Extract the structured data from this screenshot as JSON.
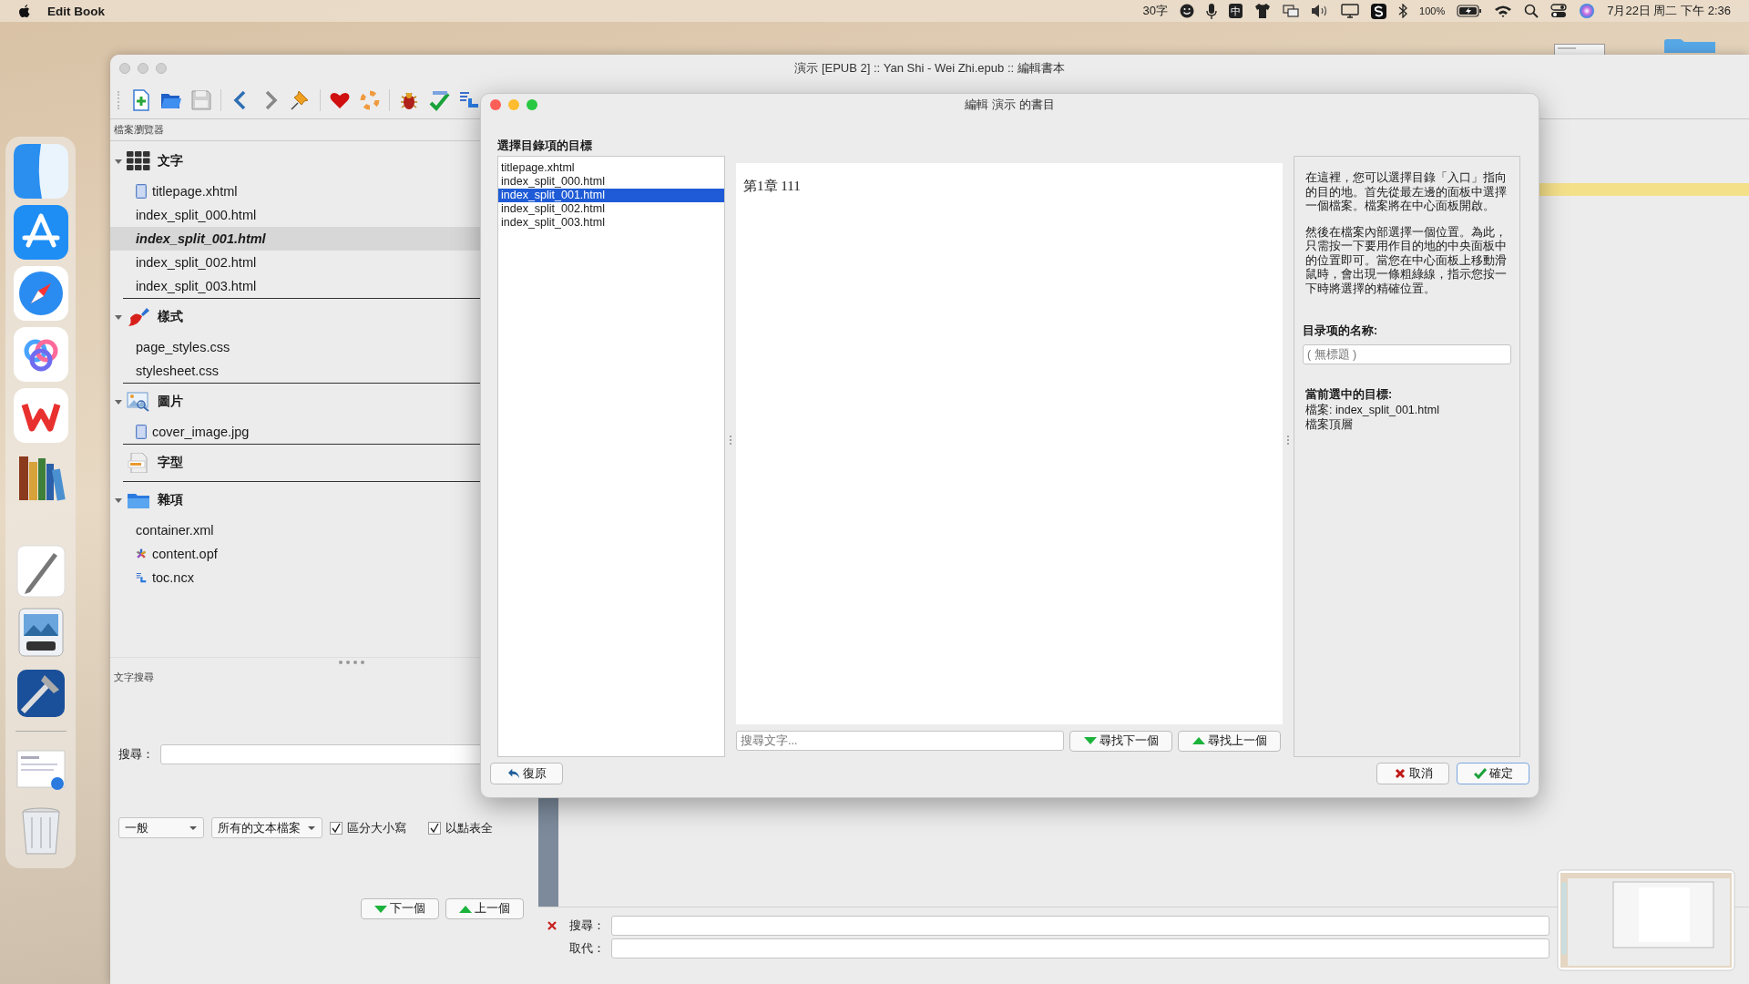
{
  "menu_bar": {
    "app_name": "Edit Book",
    "word_count": "30字",
    "input_source": "中",
    "battery": "100%",
    "clock": "7月22日 周二 下午 2:36"
  },
  "main_window": {
    "title": "演示 [EPUB 2] :: Yan Shi - Wei Zhi.epub :: 編輯書本",
    "file_browser": {
      "title": "檔案瀏覽器",
      "groups": [
        {
          "label": "文字",
          "kind": "text",
          "expanded": true,
          "children": [
            {
              "name": "titlepage.xhtml",
              "kind": "page",
              "selected": false
            },
            {
              "name": "index_split_000.html",
              "kind": "plain",
              "selected": false
            },
            {
              "name": "index_split_001.html",
              "kind": "plain",
              "selected": true
            },
            {
              "name": "index_split_002.html",
              "kind": "plain",
              "selected": false
            },
            {
              "name": "index_split_003.html",
              "kind": "plain",
              "selected": false
            }
          ]
        },
        {
          "label": "樣式",
          "kind": "styles",
          "expanded": true,
          "children": [
            {
              "name": "page_styles.css",
              "kind": "plain",
              "selected": false
            },
            {
              "name": "stylesheet.css",
              "kind": "plain",
              "selected": false
            }
          ]
        },
        {
          "label": "圖片",
          "kind": "images",
          "expanded": true,
          "children": [
            {
              "name": "cover_image.jpg",
              "kind": "page",
              "selected": false
            }
          ]
        },
        {
          "label": "字型",
          "kind": "fonts"
        },
        {
          "label": "雜項",
          "kind": "misc",
          "expanded": true,
          "children": [
            {
              "name": "container.xml",
              "kind": "plain",
              "selected": false
            },
            {
              "name": "content.opf",
              "kind": "opf",
              "selected": false
            },
            {
              "name": "toc.ncx",
              "kind": "toc",
              "selected": false
            }
          ]
        }
      ]
    },
    "text_search": {
      "title": "文字搜尋",
      "search_label": "搜尋：",
      "mode": "一般",
      "scope": "所有的文本檔案",
      "options": [
        {
          "label": "區分大小寫",
          "checked": true
        },
        {
          "label": "以點表全",
          "checked": true
        }
      ],
      "buttons": [
        {
          "label": "下一個",
          "kind": "down"
        },
        {
          "label": "上一個",
          "kind": "up"
        }
      ]
    },
    "search_replace": {
      "search_label": "搜尋：",
      "replace_label": "取代："
    }
  },
  "dialog": {
    "title": "編輯 演示 的書目",
    "list_title": "選擇目錄項的目標",
    "files": [
      {
        "name": "titlepage.xhtml",
        "selected": false
      },
      {
        "name": "index_split_000.html",
        "selected": false
      },
      {
        "name": "index_split_001.html",
        "selected": true
      },
      {
        "name": "index_split_002.html",
        "selected": false
      },
      {
        "name": "index_split_003.html",
        "selected": false
      }
    ],
    "preview_text": "第1章 111",
    "search_placeholder": "搜尋文字...",
    "find_buttons": [
      {
        "label": "尋找下一個",
        "kind": "down"
      },
      {
        "label": "尋找上一個",
        "kind": "up"
      }
    ],
    "help_paragraphs": [
      "在這裡，您可以選擇目錄「入口」指向的目的地。首先從最左邊的面板中選擇一個檔案。檔案將在中心面板開啟。",
      "然後在檔案內部選擇一個位置。為此，只需按一下要用作目的地的中央面板中的位置即可。當您在中心面板上移動滑鼠時，會出現一條粗綠線，指示您按一下時將選擇的精確位置。"
    ],
    "name_label": "目录项的名称:",
    "name_placeholder": "( 無標題 )",
    "current_label": "當前選中的目標:",
    "current_file": "檔案: index_split_001.html",
    "current_position": "檔案頂層",
    "buttons": [
      {
        "label": "復原",
        "kind": "undo"
      },
      {
        "label": "取消",
        "kind": "cancel"
      },
      {
        "label": "確定",
        "kind": "ok"
      }
    ]
  }
}
